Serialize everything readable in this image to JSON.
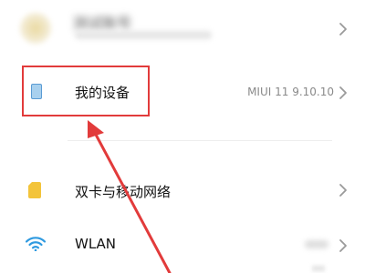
{
  "settings": {
    "account": {
      "name": "测试账号",
      "avatar_icon": "avatar-icon"
    },
    "device_row": {
      "label": "我的设备",
      "value": "MIUI 11 9.10.10",
      "icon": "phone-icon",
      "icon_color": "#a8d0ee"
    },
    "sim_row": {
      "label": "双卡与移动网络",
      "icon": "sim-card-icon",
      "icon_color": "#f3c43a"
    },
    "wlan_row": {
      "label": "WLAN",
      "icon": "wifi-icon",
      "icon_color": "#2f9ae0"
    }
  },
  "annotation": {
    "color": "#e23b3b"
  }
}
